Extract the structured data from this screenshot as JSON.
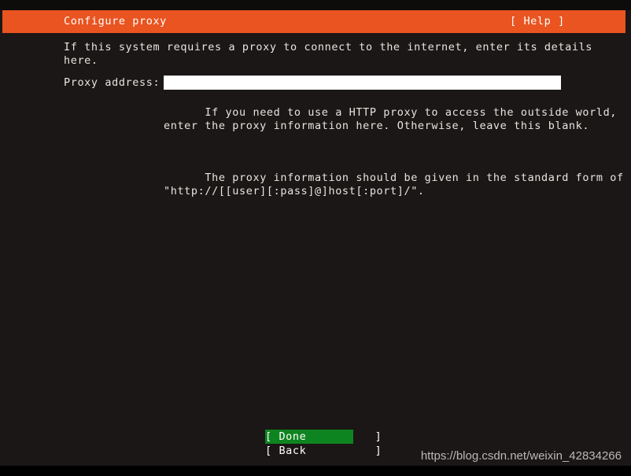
{
  "window": {
    "title": "Configure proxy",
    "help_label": "[ Help ]"
  },
  "main": {
    "intro_text": "If this system requires a proxy to connect to the internet, enter its details\nhere.",
    "field": {
      "label": "Proxy address:",
      "value": "",
      "placeholder": ""
    },
    "help_text_1": "If you need to use a HTTP proxy to access the outside world,\nenter the proxy information here. Otherwise, leave this blank.",
    "help_text_2": "The proxy information should be given in the standard form of\n\"http://[[user][:pass]@]host[:port]/\"."
  },
  "footer": {
    "done_label": "[ Done          ]",
    "back_label": "[ Back          ]"
  },
  "watermark": {
    "text": "https://blog.csdn.net/weixin_42834266"
  },
  "colors": {
    "accent_orange": "#e95420",
    "selected_green": "#0e8420",
    "background": "#1a1716",
    "foreground": "#e8e4e0"
  }
}
